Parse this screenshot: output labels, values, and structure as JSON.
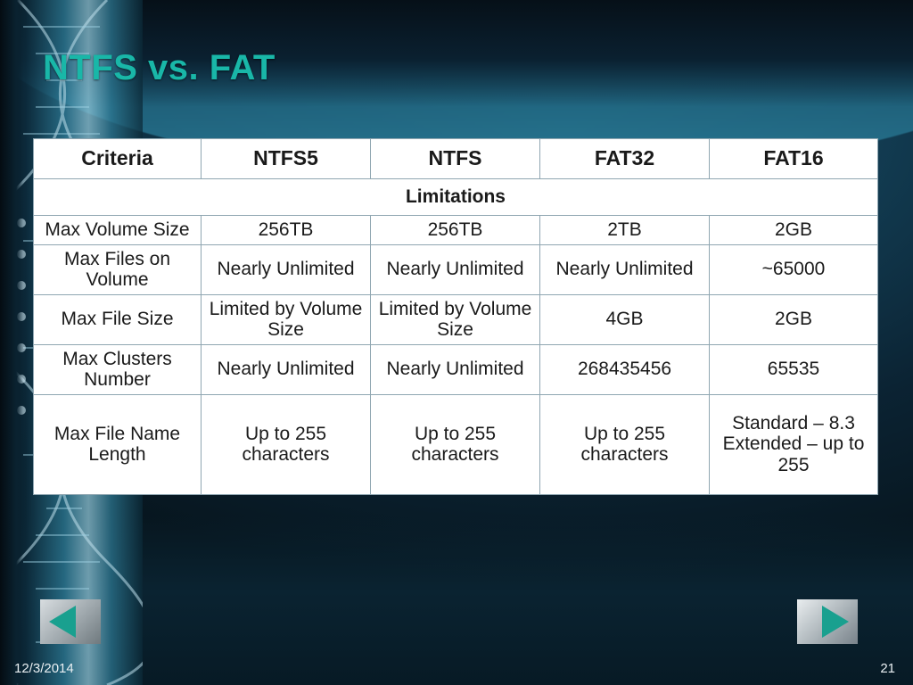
{
  "slide": {
    "title": "NTFS vs. FAT",
    "footer_date": "12/3/2014",
    "page_number": "21",
    "accent_color": "#19b7a8"
  },
  "nav": {
    "prev_label": "previous-slide",
    "next_label": "next-slide"
  },
  "table": {
    "headers": [
      "Criteria",
      "NTFS5",
      "NTFS",
      "FAT32",
      "FAT16"
    ],
    "section": "Limitations",
    "rows": [
      {
        "criteria": "Max Volume Size",
        "ntfs5": "256TB",
        "ntfs": "256TB",
        "fat32": "2TB",
        "fat16": "2GB"
      },
      {
        "criteria": "Max Files on Volume",
        "ntfs5": "Nearly Unlimited",
        "ntfs": "Nearly Unlimited",
        "fat32": "Nearly Unlimited",
        "fat16": "~65000"
      },
      {
        "criteria": "Max File Size",
        "ntfs5": "Limited by Volume Size",
        "ntfs": "Limited by Volume Size",
        "fat32": "4GB",
        "fat16": "2GB"
      },
      {
        "criteria": "Max Clusters Number",
        "ntfs5": "Nearly Unlimited",
        "ntfs": "Nearly Unlimited",
        "fat32": "268435456",
        "fat16": "65535"
      },
      {
        "criteria": "Max File Name Length",
        "ntfs5": "Up to 255 characters",
        "ntfs": "Up to 255 characters",
        "fat32": "Up to 255 characters",
        "fat16": "Standard – 8.3 Extended – up to 255"
      }
    ]
  }
}
